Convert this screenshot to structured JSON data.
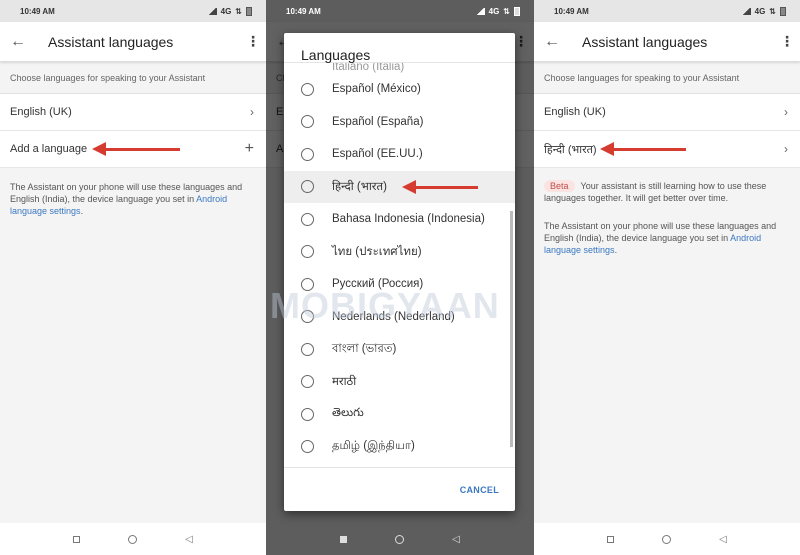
{
  "status": {
    "time": "10:49 AM",
    "network": "4G"
  },
  "left": {
    "title": "Assistant languages",
    "subheader": "Choose languages for speaking to your Assistant",
    "rows": [
      {
        "label": "English (UK)",
        "trailing": "›"
      },
      {
        "label": "Add a language",
        "trailing": "+"
      }
    ],
    "info_text": "The Assistant on your phone will use these languages and English (India), the device language you set in ",
    "info_link": "Android language settings",
    "info_end": "."
  },
  "dialog": {
    "title": "Languages",
    "partial_item": "Italiano (Italia)",
    "options": [
      "Español (México)",
      "Español (España)",
      "Español (EE.UU.)",
      "हिन्दी (भारत)",
      "Bahasa Indonesia (Indonesia)",
      "ไทย (ประเทศไทย)",
      "Русский (Россия)",
      "Nederlands (Nederland)",
      "বাংলা (ভারত)",
      "मराठी",
      "తెలుగు",
      "தமிழ் (இந்தியா)"
    ],
    "highlighted_option": "हिन्दी (भारत)",
    "cancel_label": "CANCEL"
  },
  "right": {
    "title": "Assistant languages",
    "subheader": "Choose languages for speaking to your Assistant",
    "rows": [
      {
        "label": "English (UK)",
        "trailing": "›"
      },
      {
        "label": "हिन्दी (भारत)",
        "trailing": "›"
      }
    ],
    "beta_badge": "Beta",
    "beta_text": "Your assistant is still learning how to use these languages together. It will get better over time.",
    "info_text": "The Assistant on your phone will use these languages and English (India), the device language you set in ",
    "info_link": "Android language settings",
    "info_end": "."
  },
  "icons": {
    "back": "←",
    "more": "⋮",
    "nav_back": "◁"
  },
  "watermark": "MOBIGYAAN",
  "colors": {
    "accent": "#3b78c2",
    "arrow": "#d63b2f",
    "beta_bg": "#fbe3e1",
    "beta_text": "#c0504d"
  }
}
